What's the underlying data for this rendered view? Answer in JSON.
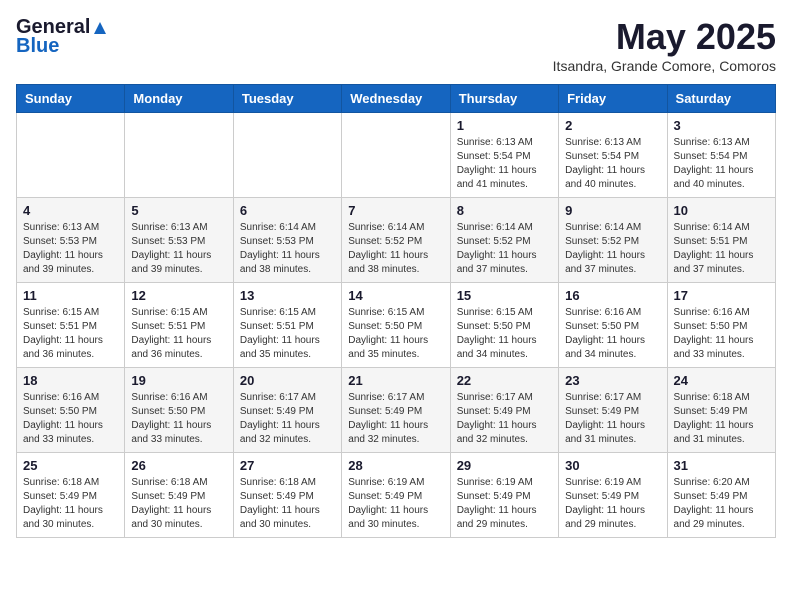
{
  "logo": {
    "general": "General",
    "blue": "Blue"
  },
  "header": {
    "month_title": "May 2025",
    "subtitle": "Itsandra, Grande Comore, Comoros"
  },
  "weekdays": [
    "Sunday",
    "Monday",
    "Tuesday",
    "Wednesday",
    "Thursday",
    "Friday",
    "Saturday"
  ],
  "weeks": [
    [
      {
        "day": "",
        "info": ""
      },
      {
        "day": "",
        "info": ""
      },
      {
        "day": "",
        "info": ""
      },
      {
        "day": "",
        "info": ""
      },
      {
        "day": "1",
        "info": "Sunrise: 6:13 AM\nSunset: 5:54 PM\nDaylight: 11 hours and 41 minutes."
      },
      {
        "day": "2",
        "info": "Sunrise: 6:13 AM\nSunset: 5:54 PM\nDaylight: 11 hours and 40 minutes."
      },
      {
        "day": "3",
        "info": "Sunrise: 6:13 AM\nSunset: 5:54 PM\nDaylight: 11 hours and 40 minutes."
      }
    ],
    [
      {
        "day": "4",
        "info": "Sunrise: 6:13 AM\nSunset: 5:53 PM\nDaylight: 11 hours and 39 minutes."
      },
      {
        "day": "5",
        "info": "Sunrise: 6:13 AM\nSunset: 5:53 PM\nDaylight: 11 hours and 39 minutes."
      },
      {
        "day": "6",
        "info": "Sunrise: 6:14 AM\nSunset: 5:53 PM\nDaylight: 11 hours and 38 minutes."
      },
      {
        "day": "7",
        "info": "Sunrise: 6:14 AM\nSunset: 5:52 PM\nDaylight: 11 hours and 38 minutes."
      },
      {
        "day": "8",
        "info": "Sunrise: 6:14 AM\nSunset: 5:52 PM\nDaylight: 11 hours and 37 minutes."
      },
      {
        "day": "9",
        "info": "Sunrise: 6:14 AM\nSunset: 5:52 PM\nDaylight: 11 hours and 37 minutes."
      },
      {
        "day": "10",
        "info": "Sunrise: 6:14 AM\nSunset: 5:51 PM\nDaylight: 11 hours and 37 minutes."
      }
    ],
    [
      {
        "day": "11",
        "info": "Sunrise: 6:15 AM\nSunset: 5:51 PM\nDaylight: 11 hours and 36 minutes."
      },
      {
        "day": "12",
        "info": "Sunrise: 6:15 AM\nSunset: 5:51 PM\nDaylight: 11 hours and 36 minutes."
      },
      {
        "day": "13",
        "info": "Sunrise: 6:15 AM\nSunset: 5:51 PM\nDaylight: 11 hours and 35 minutes."
      },
      {
        "day": "14",
        "info": "Sunrise: 6:15 AM\nSunset: 5:50 PM\nDaylight: 11 hours and 35 minutes."
      },
      {
        "day": "15",
        "info": "Sunrise: 6:15 AM\nSunset: 5:50 PM\nDaylight: 11 hours and 34 minutes."
      },
      {
        "day": "16",
        "info": "Sunrise: 6:16 AM\nSunset: 5:50 PM\nDaylight: 11 hours and 34 minutes."
      },
      {
        "day": "17",
        "info": "Sunrise: 6:16 AM\nSunset: 5:50 PM\nDaylight: 11 hours and 33 minutes."
      }
    ],
    [
      {
        "day": "18",
        "info": "Sunrise: 6:16 AM\nSunset: 5:50 PM\nDaylight: 11 hours and 33 minutes."
      },
      {
        "day": "19",
        "info": "Sunrise: 6:16 AM\nSunset: 5:50 PM\nDaylight: 11 hours and 33 minutes."
      },
      {
        "day": "20",
        "info": "Sunrise: 6:17 AM\nSunset: 5:49 PM\nDaylight: 11 hours and 32 minutes."
      },
      {
        "day": "21",
        "info": "Sunrise: 6:17 AM\nSunset: 5:49 PM\nDaylight: 11 hours and 32 minutes."
      },
      {
        "day": "22",
        "info": "Sunrise: 6:17 AM\nSunset: 5:49 PM\nDaylight: 11 hours and 32 minutes."
      },
      {
        "day": "23",
        "info": "Sunrise: 6:17 AM\nSunset: 5:49 PM\nDaylight: 11 hours and 31 minutes."
      },
      {
        "day": "24",
        "info": "Sunrise: 6:18 AM\nSunset: 5:49 PM\nDaylight: 11 hours and 31 minutes."
      }
    ],
    [
      {
        "day": "25",
        "info": "Sunrise: 6:18 AM\nSunset: 5:49 PM\nDaylight: 11 hours and 30 minutes."
      },
      {
        "day": "26",
        "info": "Sunrise: 6:18 AM\nSunset: 5:49 PM\nDaylight: 11 hours and 30 minutes."
      },
      {
        "day": "27",
        "info": "Sunrise: 6:18 AM\nSunset: 5:49 PM\nDaylight: 11 hours and 30 minutes."
      },
      {
        "day": "28",
        "info": "Sunrise: 6:19 AM\nSunset: 5:49 PM\nDaylight: 11 hours and 30 minutes."
      },
      {
        "day": "29",
        "info": "Sunrise: 6:19 AM\nSunset: 5:49 PM\nDaylight: 11 hours and 29 minutes."
      },
      {
        "day": "30",
        "info": "Sunrise: 6:19 AM\nSunset: 5:49 PM\nDaylight: 11 hours and 29 minutes."
      },
      {
        "day": "31",
        "info": "Sunrise: 6:20 AM\nSunset: 5:49 PM\nDaylight: 11 hours and 29 minutes."
      }
    ]
  ]
}
